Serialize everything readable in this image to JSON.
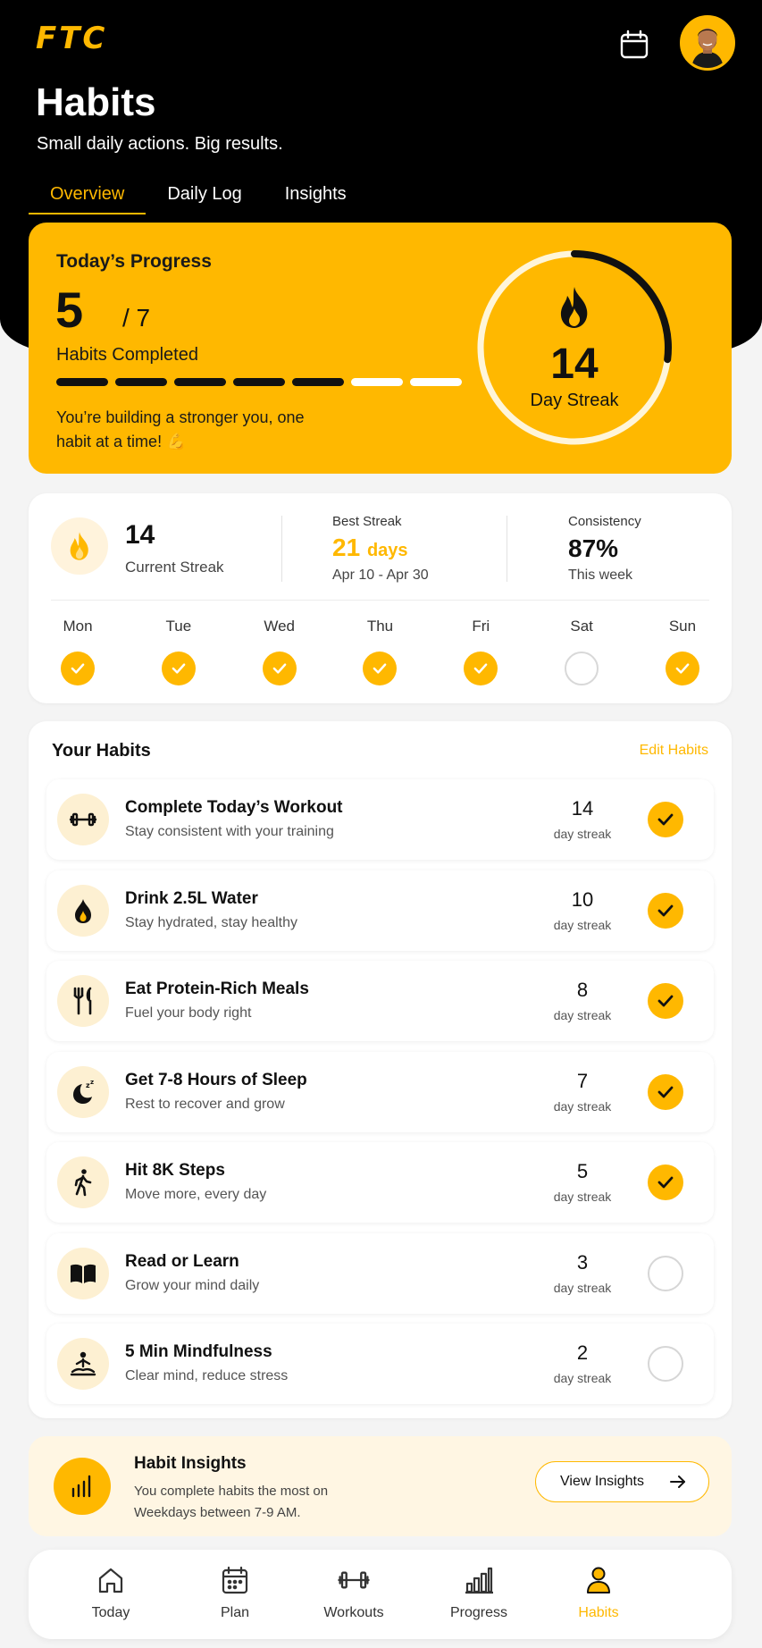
{
  "header": {
    "logo": "FTC",
    "title": "Habits",
    "subtitle": "Small daily actions. Big results.",
    "tabs": [
      {
        "label": "Overview",
        "active": true
      },
      {
        "label": "Daily Log",
        "active": false
      },
      {
        "label": "Insights",
        "active": false
      }
    ]
  },
  "progress": {
    "title": "Today’s Progress",
    "completed": "5",
    "total": "/ 7",
    "completed_label": "Habits Completed",
    "segments_done": 5,
    "segments_total": 7,
    "message": "You’re building a stronger you, one habit at a time! 💪",
    "streak_value": "14",
    "streak_label": "Day Streak",
    "ring_fraction": 0.27
  },
  "streaks": {
    "current_value": "14",
    "current_label": "Current Streak",
    "best_label": "Best Streak",
    "best_value": "21",
    "best_unit": "days",
    "best_range": "Apr 10 - Apr 30",
    "consistency_label": "Consistency",
    "consistency_value": "87%",
    "consistency_sub": "This week",
    "days": [
      {
        "name": "Mon",
        "done": true
      },
      {
        "name": "Tue",
        "done": true
      },
      {
        "name": "Wed",
        "done": true
      },
      {
        "name": "Thu",
        "done": true
      },
      {
        "name": "Fri",
        "done": true
      },
      {
        "name": "Sat",
        "done": false
      },
      {
        "name": "Sun",
        "done": true
      }
    ]
  },
  "habits": {
    "title": "Your Habits",
    "edit_label": "Edit Habits",
    "streak_label": "day streak",
    "items": [
      {
        "icon": "dumbbell-icon",
        "title": "Complete Today’s Workout",
        "subtitle": "Stay consistent with your training",
        "streak": "14",
        "done": true
      },
      {
        "icon": "water-drop-icon",
        "title": "Drink 2.5L Water",
        "subtitle": "Stay hydrated, stay healthy",
        "streak": "10",
        "done": true
      },
      {
        "icon": "fork-knife-icon",
        "title": "Eat Protein-Rich Meals",
        "subtitle": "Fuel your body right",
        "streak": "8",
        "done": true
      },
      {
        "icon": "moon-sleep-icon",
        "title": "Get 7-8 Hours of Sleep",
        "subtitle": "Rest to recover and grow",
        "streak": "7",
        "done": true
      },
      {
        "icon": "walking-icon",
        "title": "Hit 8K Steps",
        "subtitle": "Move more, every day",
        "streak": "5",
        "done": true
      },
      {
        "icon": "book-icon",
        "title": "Read or Learn",
        "subtitle": "Grow your mind daily",
        "streak": "3",
        "done": false
      },
      {
        "icon": "meditation-icon",
        "title": "5 Min Mindfulness",
        "subtitle": "Clear mind, reduce stress",
        "streak": "2",
        "done": false
      }
    ]
  },
  "insights": {
    "title": "Habit Insights",
    "body": "You complete habits the most on Weekdays between 7-9 AM.",
    "button_label": "View Insights"
  },
  "nav": {
    "items": [
      {
        "label": "Today",
        "icon": "home-icon",
        "active": false
      },
      {
        "label": "Plan",
        "icon": "calendar-icon",
        "active": false
      },
      {
        "label": "Workouts",
        "icon": "dumbbell-icon",
        "active": false
      },
      {
        "label": "Progress",
        "icon": "bar-chart-icon",
        "active": false
      },
      {
        "label": "Habits",
        "icon": "person-icon",
        "active": true
      }
    ]
  },
  "colors": {
    "accent": "#ffb800",
    "dark": "#000000",
    "light_accent": "#fff6e3"
  }
}
